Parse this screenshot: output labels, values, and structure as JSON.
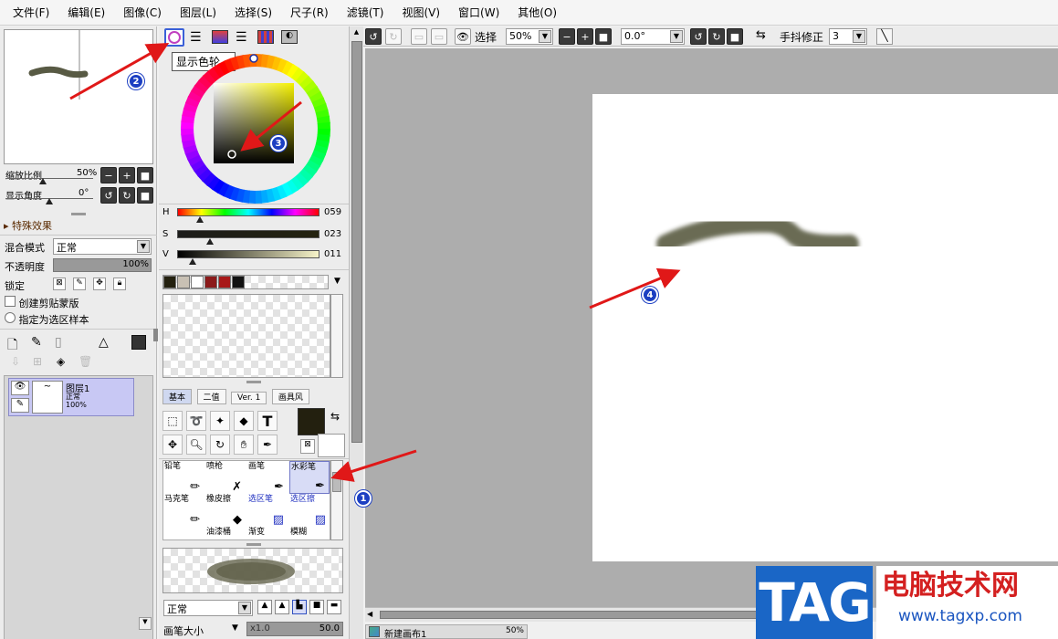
{
  "menu": [
    "文件(F)",
    "编辑(E)",
    "图像(C)",
    "图层(L)",
    "选择(S)",
    "尺子(R)",
    "滤镜(T)",
    "视图(V)",
    "窗口(W)",
    "其他(O)"
  ],
  "navigator": {
    "zoom_label": "缩放比例",
    "zoom_value": "50%",
    "angle_label": "显示角度",
    "angle_value": "0°"
  },
  "effects": {
    "title": "特殊效果"
  },
  "layer_props": {
    "blend_label": "混合模式",
    "blend_value": "正常",
    "opacity_label": "不透明度",
    "opacity_value": "100%",
    "lock_label": "锁定",
    "clipping_label": "创建剪贴蒙版",
    "sample_label": "指定为选区样本"
  },
  "layer": {
    "name": "图层1",
    "mode": "正常",
    "opacity": "100%"
  },
  "color": {
    "tooltip": "显示色轮。",
    "h_label": "H",
    "h_value": "059",
    "h_level": 0.16,
    "s_label": "S",
    "s_value": "023",
    "s_level": 0.23,
    "v_label": "V",
    "v_value": "011",
    "v_level": 0.11,
    "current": "#23200f",
    "swatches": [
      "#23200f",
      "#c8c0b4",
      "#ffffff",
      "#8b1a1a",
      "#a81818",
      "#111111"
    ]
  },
  "tool_tabs": [
    "基本",
    "二值",
    "Ver. 1",
    "画具风"
  ],
  "brushes": [
    "铅笔",
    "喷枪",
    "画笔",
    "水彩笔",
    "马克笔",
    "橡皮擦",
    "选区笔",
    "选区擦",
    "",
    "油漆桶",
    "渐变",
    "模糊"
  ],
  "brush_props": {
    "mode_value": "正常",
    "size_label": "画笔大小",
    "size_mult": "x1.0",
    "size_value": "50.0"
  },
  "toolbar": {
    "select_label": "选择",
    "zoom_value": "50%",
    "angle_value": "0.0°",
    "stabilizer_label": "手抖修正",
    "stabilizer_value": "3"
  },
  "canvas_tab": {
    "name": "新建画布1",
    "zoom": "50%"
  },
  "watermark": {
    "tag": "TAG",
    "title": "电脑技术网",
    "url": "www.tagxp.com"
  },
  "annotations": [
    "1",
    "2",
    "3",
    "4"
  ]
}
